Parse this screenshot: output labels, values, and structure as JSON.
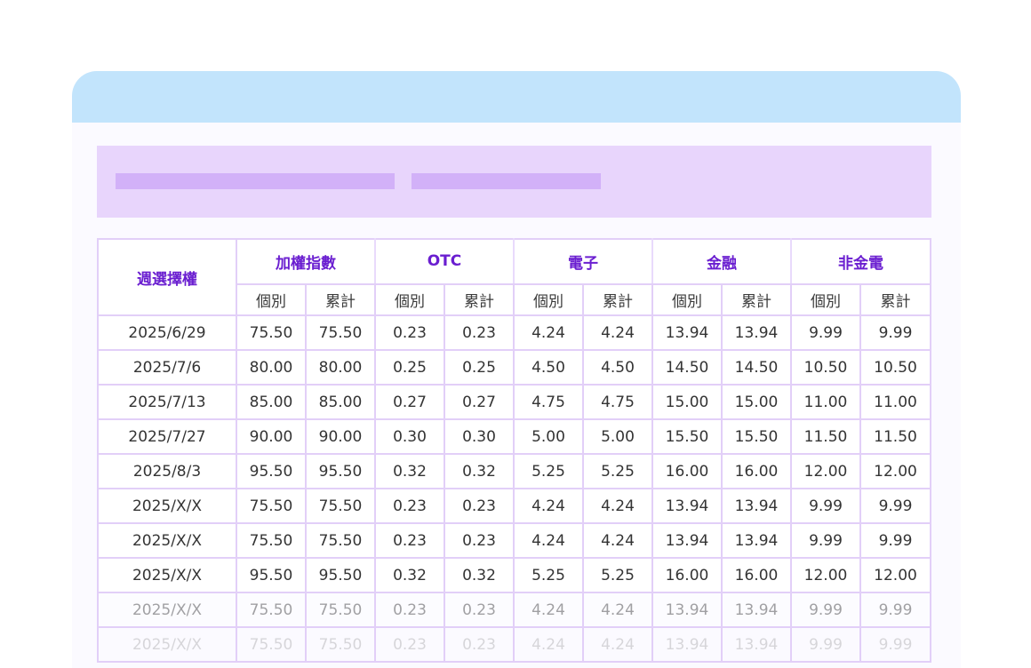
{
  "table": {
    "corner_label": "週選擇權",
    "groups": [
      {
        "label": "加權指數"
      },
      {
        "label": "OTC"
      },
      {
        "label": "電子"
      },
      {
        "label": "金融"
      },
      {
        "label": "非金電"
      }
    ],
    "sub_labels": [
      "個別",
      "累計"
    ],
    "rows": [
      {
        "date": "2025/6/29",
        "values": [
          "75.50",
          "75.50",
          "0.23",
          "0.23",
          "4.24",
          "4.24",
          "13.94",
          "13.94",
          "9.99",
          "9.99"
        ]
      },
      {
        "date": "2025/7/6",
        "values": [
          "80.00",
          "80.00",
          "0.25",
          "0.25",
          "4.50",
          "4.50",
          "14.50",
          "14.50",
          "10.50",
          "10.50"
        ]
      },
      {
        "date": "2025/7/13",
        "values": [
          "85.00",
          "85.00",
          "0.27",
          "0.27",
          "4.75",
          "4.75",
          "15.00",
          "15.00",
          "11.00",
          "11.00"
        ]
      },
      {
        "date": "2025/7/27",
        "values": [
          "90.00",
          "90.00",
          "0.30",
          "0.30",
          "5.00",
          "5.00",
          "15.50",
          "15.50",
          "11.50",
          "11.50"
        ]
      },
      {
        "date": "2025/8/3",
        "values": [
          "95.50",
          "95.50",
          "0.32",
          "0.32",
          "5.25",
          "5.25",
          "16.00",
          "16.00",
          "12.00",
          "12.00"
        ]
      },
      {
        "date": "2025/X/X",
        "values": [
          "75.50",
          "75.50",
          "0.23",
          "0.23",
          "4.24",
          "4.24",
          "13.94",
          "13.94",
          "9.99",
          "9.99"
        ]
      },
      {
        "date": "2025/X/X",
        "values": [
          "75.50",
          "75.50",
          "0.23",
          "0.23",
          "4.24",
          "4.24",
          "13.94",
          "13.94",
          "9.99",
          "9.99"
        ]
      },
      {
        "date": "2025/X/X",
        "values": [
          "95.50",
          "95.50",
          "0.32",
          "0.32",
          "5.25",
          "5.25",
          "16.00",
          "16.00",
          "12.00",
          "12.00"
        ]
      },
      {
        "date": "2025/X/X",
        "values": [
          "75.50",
          "75.50",
          "0.23",
          "0.23",
          "4.24",
          "4.24",
          "13.94",
          "13.94",
          "9.99",
          "9.99"
        ]
      },
      {
        "date": "2025/X/X",
        "values": [
          "75.50",
          "75.50",
          "0.23",
          "0.23",
          "4.24",
          "4.24",
          "13.94",
          "13.94",
          "9.99",
          "9.99"
        ]
      }
    ]
  },
  "colors": {
    "header_bg": "#c2e4fc",
    "banner_bg": "#e8d5fc",
    "placeholder_bar": "#d2b1f8",
    "accent_text": "#6a1ed0",
    "grid_border": "#e2cff8"
  }
}
